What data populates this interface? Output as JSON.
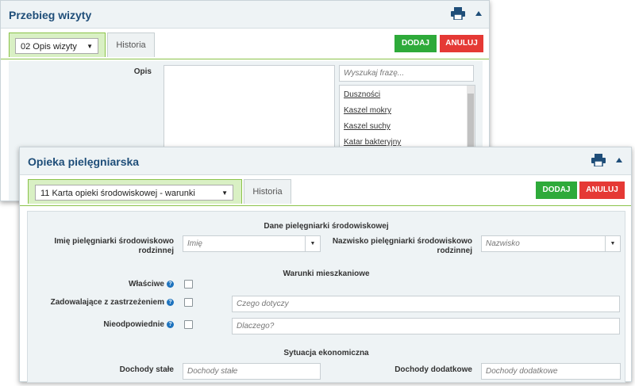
{
  "back_panel": {
    "title": "Przebieg wizyty",
    "select_value": "02 Opis wizyty",
    "history_tab": "Historia",
    "add_button": "DODAJ",
    "cancel_button": "ANULUJ",
    "description_label": "Opis",
    "search_placeholder": "Wyszukaj frazę...",
    "phrases": [
      "Duszności",
      "Kaszel mokry",
      "Kaszel suchy",
      "Katar bakteryjny"
    ]
  },
  "front_panel": {
    "title": "Opieka pielęgniarska",
    "select_value": "11 Karta opieki środowiskowej - warunki",
    "history_tab": "Historia",
    "add_button": "DODAJ",
    "cancel_button": "ANULUJ",
    "section_nurse": "Dane pielęgniarki środowiskowej",
    "nurse_first_name_label": "Imię pielęgniarki środowiskowo rodzinnej",
    "nurse_first_name_placeholder": "Imię",
    "nurse_last_name_label": "Nazwisko pielęgniarki środowiskowo rodzinnej",
    "nurse_last_name_placeholder": "Nazwisko",
    "section_living": "Warunki mieszkaniowe",
    "proper_label": "Właściwe",
    "reserved_label": "Zadowalające z zastrzeżeniem",
    "reserved_placeholder": "Czego dotyczy",
    "inadequate_label": "Nieodpowiednie",
    "inadequate_placeholder": "Dlaczego?",
    "section_economic": "Sytuacja ekonomiczna",
    "fixed_income_label": "Dochody stałe",
    "fixed_income_placeholder": "Dochody stałe",
    "extra_income_label": "Dochody dodatkowe",
    "extra_income_placeholder": "Dochody dodatkowe"
  },
  "colors": {
    "title": "#1f4e79",
    "add_button": "#2eaa3a",
    "cancel_button": "#e53935",
    "tab_green": "#d9f0c4",
    "help_icon": "#1e73be"
  }
}
